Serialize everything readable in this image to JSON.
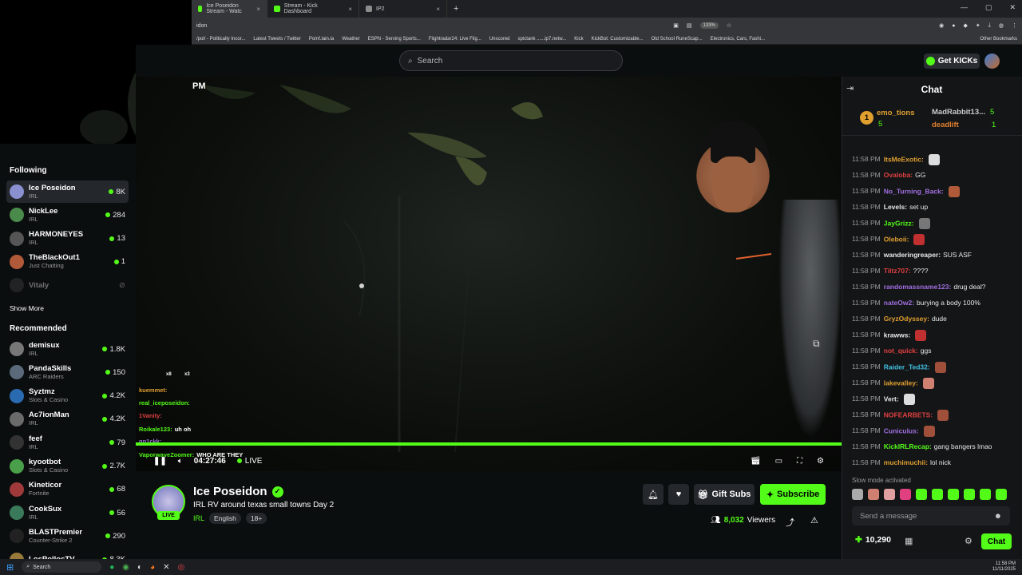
{
  "browser": {
    "tabs": [
      {
        "label": "Ice Poseidon Stream - Watc",
        "active": true,
        "color": "#53fc18"
      },
      {
        "label": "Stream - Kick Dashboard",
        "active": false,
        "color": "#53fc18"
      },
      {
        "label": "IP2",
        "active": false,
        "color": "#8c8c8c"
      }
    ],
    "address": "idon",
    "zoom": "133%",
    "bookmarks": [
      "/pol/ - Politically Incor...",
      "Latest Tweets / Twitter",
      "Pomf.lain.la",
      "Weather",
      "ESPN - Serving Sports...",
      "Flightradar24: Live Flig...",
      "Unscored",
      "spictank ......ip7.netw...",
      "Kick",
      "KickBot: Customizable...",
      "Old School RuneScap...",
      "Electronics, Cars, Fashi..."
    ],
    "other_bookmarks": "Other Bookmarks"
  },
  "header": {
    "search_placeholder": "Search",
    "get_kicks": "Get KICKs"
  },
  "sidebar": {
    "following_title": "Following",
    "following": [
      {
        "name": "Ice Poseidon",
        "category": "IRL",
        "viewers": "8K",
        "selected": true,
        "color": "#8a8fd0"
      },
      {
        "name": "NickLee",
        "category": "IRL",
        "viewers": "284",
        "color": "#4a8a4a"
      },
      {
        "name": "HARMONEYES",
        "category": "IRL",
        "viewers": "13",
        "color": "#555555"
      },
      {
        "name": "TheBlackOut1",
        "category": "Just Chatting",
        "viewers": "1",
        "color": "#b05a3a"
      },
      {
        "name": "Vitaly",
        "category": "",
        "viewers": "",
        "offline": true,
        "color": "#444444"
      }
    ],
    "show_more": "Show More",
    "recommended_title": "Recommended",
    "recommended": [
      {
        "name": "demisux",
        "category": "IRL",
        "viewers": "1.8K",
        "color": "#777777"
      },
      {
        "name": "PandaSkills",
        "category": "ARC Raiders",
        "viewers": "150",
        "color": "#5a6a7a"
      },
      {
        "name": "Syztmz",
        "category": "Slots & Casino",
        "viewers": "4.2K",
        "color": "#2a6ab0"
      },
      {
        "name": "Ac7ionMan",
        "category": "IRL",
        "viewers": "4.2K",
        "color": "#6a6a6a"
      },
      {
        "name": "feef",
        "category": "IRL",
        "viewers": "79",
        "color": "#333333"
      },
      {
        "name": "kyootbot",
        "category": "Slots & Casino",
        "viewers": "2.7K",
        "color": "#4aa04a"
      },
      {
        "name": "Kineticor",
        "category": "Fortnite",
        "viewers": "68",
        "color": "#a03a3a"
      },
      {
        "name": "CookSux",
        "category": "IRL",
        "viewers": "56",
        "color": "#3a7a5a"
      },
      {
        "name": "BLASTPremier",
        "category": "Counter-Strike 2",
        "viewers": "290",
        "color": "#222222"
      },
      {
        "name": "LosPollosTV",
        "category": "",
        "viewers": "8.3K",
        "color": "#9a7a3a"
      }
    ]
  },
  "video": {
    "time_overlay": "PM",
    "elapsed": "04:27:46",
    "live_label": "LIVE",
    "overlay_chat": [
      {
        "user": "kuemmet:",
        "msg": "",
        "color": "#e0a030"
      },
      {
        "user": "real_iceposeidon:",
        "msg": "",
        "color": "#53fc18"
      },
      {
        "user": "1Vanity:",
        "msg": "",
        "color": "#e04040"
      },
      {
        "user": "Roikale123:",
        "msg": "uh oh",
        "color": "#53fc18"
      },
      {
        "user": "gn1ckk:",
        "msg": "",
        "color": "#a070e0"
      },
      {
        "user": "VaporwaveZoomer:",
        "msg": "WHO ARE THEY",
        "color": "#53fc18"
      }
    ],
    "overlay_badges": [
      "x8",
      "x3"
    ]
  },
  "channel": {
    "name": "Ice Poseidon",
    "live_badge": "LIVE",
    "title": "IRL RV around texas small towns Day 2",
    "category": "IRL",
    "tags": [
      "English",
      "18+"
    ],
    "gift_subs": "Gift Subs",
    "subscribe": "Subscribe",
    "viewers": "8,032",
    "viewers_label": "Viewers"
  },
  "chat": {
    "title": "Chat",
    "leaderboard": [
      {
        "rank": "1",
        "name": "emo_tions",
        "count": "5",
        "color": "#e0a030"
      },
      {
        "name": "MadRabbit13...",
        "count": "5",
        "color": "#cccccc"
      },
      {
        "name": "deadlift",
        "count": "1",
        "color": "#e08030"
      }
    ],
    "messages": [
      {
        "time": "11:58 PM",
        "user": "ItsMeExotic:",
        "msg": "",
        "color": "#e0a030",
        "emote": "#dddddd"
      },
      {
        "time": "11:58 PM",
        "user": "Ovaloba:",
        "msg": "GG",
        "color": "#e04040"
      },
      {
        "time": "11:58 PM",
        "user": "No_Turning_Back:",
        "msg": "",
        "color": "#a070e0",
        "emote": "#b05a3a"
      },
      {
        "time": "11:58 PM",
        "user": "Levels:",
        "msg": "set up",
        "color": "#e8e8e8"
      },
      {
        "time": "11:58 PM",
        "user": "JayGrizz:",
        "msg": "",
        "color": "#53fc18",
        "emote": "#777777"
      },
      {
        "time": "11:58 PM",
        "user": "Oleboii:",
        "msg": "",
        "color": "#e0a030",
        "emote": "#c03030"
      },
      {
        "time": "11:58 PM",
        "user": "wanderingreaper:",
        "msg": "SUS ASF",
        "color": "#e8e8e8"
      },
      {
        "time": "11:58 PM",
        "user": "Tiltz707:",
        "msg": "????",
        "color": "#e04040"
      },
      {
        "time": "11:58 PM",
        "user": "randomassname123:",
        "msg": "drug deal?",
        "color": "#a070e0"
      },
      {
        "time": "11:58 PM",
        "user": "nateOw2:",
        "msg": "burying a body 100%",
        "color": "#a070e0"
      },
      {
        "time": "11:58 PM",
        "user": "GryzOdyssey:",
        "msg": "dude",
        "color": "#e0a030"
      },
      {
        "time": "11:58 PM",
        "user": "krawws:",
        "msg": "",
        "color": "#e8e8e8",
        "emote": "#c03030"
      },
      {
        "time": "11:58 PM",
        "user": "not_quick:",
        "msg": "ggs",
        "color": "#e04040"
      },
      {
        "time": "11:58 PM",
        "user": "Raider_Ted32:",
        "msg": "",
        "color": "#40c0e0",
        "emote": "#a0503a"
      },
      {
        "time": "11:58 PM",
        "user": "lakevalley:",
        "msg": "",
        "color": "#e0a030",
        "emote": "#d08070"
      },
      {
        "time": "11:58 PM",
        "user": "Vert:",
        "msg": "",
        "color": "#e8e8e8",
        "emote": "#dddddd"
      },
      {
        "time": "11:58 PM",
        "user": "NOFEARBETS:",
        "msg": "",
        "color": "#e04040",
        "emote": "#a0503a"
      },
      {
        "time": "11:58 PM",
        "user": "Cuniculus:",
        "msg": "",
        "color": "#a070e0",
        "emote": "#a0503a"
      },
      {
        "time": "11:58 PM",
        "user": "KickIRLRecap:",
        "msg": "gang bangers lmao",
        "color": "#53fc18"
      },
      {
        "time": "11:58 PM",
        "user": "muchimuchii:",
        "msg": "lol nick",
        "color": "#e0a030"
      }
    ],
    "slow_mode": "Slow mode activated",
    "input_placeholder": "Send a message",
    "points": "10,290",
    "chat_button": "Chat"
  },
  "taskbar": {
    "search": "Search",
    "time": "11:58 PM",
    "date": "11/11/2025"
  }
}
